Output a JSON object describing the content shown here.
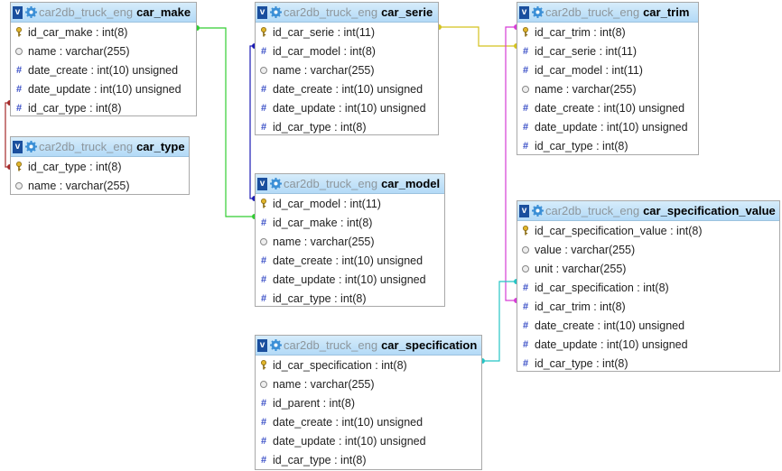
{
  "database": "car2db_truck_eng",
  "tables": [
    {
      "key": "car_make",
      "name": "car_make",
      "columns": [
        {
          "label": "id_car_make : int(8)",
          "icon": "key"
        },
        {
          "label": "name : varchar(255)",
          "icon": "text"
        },
        {
          "label": "date_create : int(10) unsigned",
          "icon": "num"
        },
        {
          "label": "date_update : int(10) unsigned",
          "icon": "num"
        },
        {
          "label": "id_car_type : int(8)",
          "icon": "num"
        }
      ]
    },
    {
      "key": "car_type",
      "name": "car_type",
      "columns": [
        {
          "label": "id_car_type : int(8)",
          "icon": "key"
        },
        {
          "label": "name : varchar(255)",
          "icon": "text"
        }
      ]
    },
    {
      "key": "car_serie",
      "name": "car_serie",
      "columns": [
        {
          "label": "id_car_serie : int(11)",
          "icon": "key"
        },
        {
          "label": "id_car_model : int(8)",
          "icon": "num"
        },
        {
          "label": "name : varchar(255)",
          "icon": "text"
        },
        {
          "label": "date_create : int(10) unsigned",
          "icon": "num"
        },
        {
          "label": "date_update : int(10) unsigned",
          "icon": "num"
        },
        {
          "label": "id_car_type : int(8)",
          "icon": "num"
        }
      ]
    },
    {
      "key": "car_model",
      "name": "car_model",
      "columns": [
        {
          "label": "id_car_model : int(11)",
          "icon": "key"
        },
        {
          "label": "id_car_make : int(8)",
          "icon": "num"
        },
        {
          "label": "name : varchar(255)",
          "icon": "text"
        },
        {
          "label": "date_create : int(10) unsigned",
          "icon": "num"
        },
        {
          "label": "date_update : int(10) unsigned",
          "icon": "num"
        },
        {
          "label": "id_car_type : int(8)",
          "icon": "num"
        }
      ]
    },
    {
      "key": "car_specification",
      "name": "car_specification",
      "columns": [
        {
          "label": "id_car_specification : int(8)",
          "icon": "key"
        },
        {
          "label": "name : varchar(255)",
          "icon": "text"
        },
        {
          "label": "id_parent : int(8)",
          "icon": "num"
        },
        {
          "label": "date_create : int(10) unsigned",
          "icon": "num"
        },
        {
          "label": "date_update : int(10) unsigned",
          "icon": "num"
        },
        {
          "label": "id_car_type : int(8)",
          "icon": "num"
        }
      ]
    },
    {
      "key": "car_trim",
      "name": "car_trim",
      "columns": [
        {
          "label": "id_car_trim : int(8)",
          "icon": "key"
        },
        {
          "label": "id_car_serie : int(11)",
          "icon": "num"
        },
        {
          "label": "id_car_model : int(11)",
          "icon": "num"
        },
        {
          "label": "name : varchar(255)",
          "icon": "text"
        },
        {
          "label": "date_create : int(10) unsigned",
          "icon": "num"
        },
        {
          "label": "date_update : int(10) unsigned",
          "icon": "num"
        },
        {
          "label": "id_car_type : int(8)",
          "icon": "num"
        }
      ]
    },
    {
      "key": "car_specification_value",
      "name": "car_specification_value",
      "columns": [
        {
          "label": "id_car_specification_value : int(8)",
          "icon": "key"
        },
        {
          "label": "value : varchar(255)",
          "icon": "text"
        },
        {
          "label": "unit : varchar(255)",
          "icon": "text"
        },
        {
          "label": "id_car_specification : int(8)",
          "icon": "num"
        },
        {
          "label": "id_car_trim : int(8)",
          "icon": "num"
        },
        {
          "label": "date_create : int(10) unsigned",
          "icon": "num"
        },
        {
          "label": "date_update : int(10) unsigned",
          "icon": "num"
        },
        {
          "label": "id_car_type : int(8)",
          "icon": "num"
        }
      ]
    }
  ],
  "relations": [
    {
      "from": "car_make.id_car_type",
      "to": "car_type.id_car_type",
      "color": "#a52a2a"
    },
    {
      "from": "car_model.id_car_make",
      "to": "car_make.id_car_make",
      "color": "#32cd32"
    },
    {
      "from": "car_serie.id_car_model",
      "to": "car_model.id_car_model",
      "color": "#1c1cb4"
    },
    {
      "from": "car_trim.id_car_serie",
      "to": "car_serie.id_car_serie",
      "color": "#d4c21e"
    },
    {
      "from": "car_specification_value.id_car_trim",
      "to": "car_trim.id_car_trim",
      "color": "#d63cd6"
    },
    {
      "from": "car_specification_value.id_car_specification",
      "to": "car_specification.id_car_specification",
      "color": "#25c5c5"
    }
  ],
  "icons": {
    "toggle": "v-toggle-icon",
    "gear": "gear-icon",
    "key": "key-icon",
    "num": "hash-icon",
    "text": "text-circle-icon"
  }
}
